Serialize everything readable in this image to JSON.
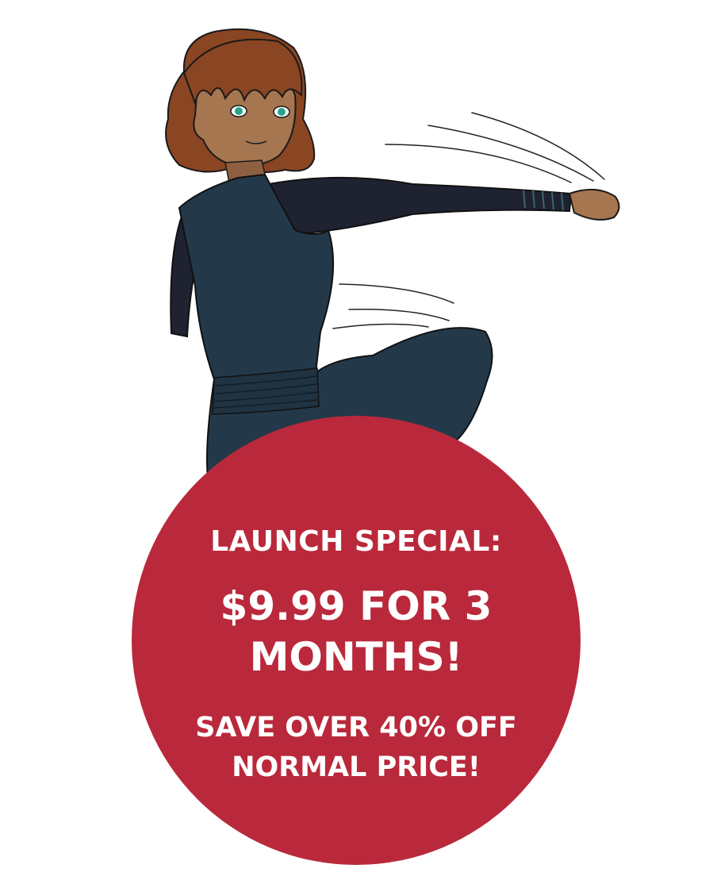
{
  "promo": {
    "headline": "LAUNCH SPECIAL:",
    "offer": "$9.99 FOR 3 MONTHS!",
    "savings": "SAVE OVER 40% OFF NORMAL PRICE!"
  },
  "illustration": {
    "subject": "girl-punching-illustration"
  },
  "colors": {
    "badge": "#b9293b",
    "text": "#ffffff",
    "hair": "#8a4522",
    "skin": "#a67650",
    "dress": "#23394a",
    "sleeve": "#1f2231"
  }
}
